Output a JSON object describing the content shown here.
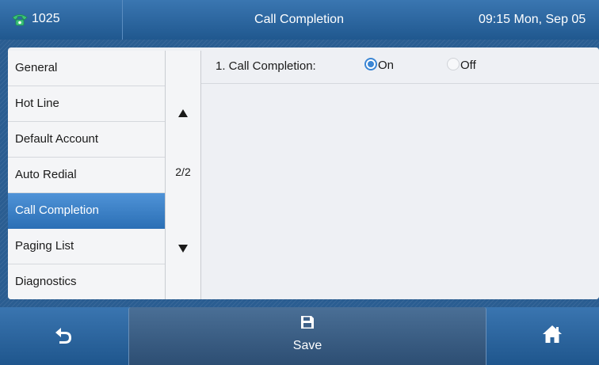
{
  "topbar": {
    "account": "1025",
    "title": "Call Completion",
    "clock": "09:15 Mon, Sep 05"
  },
  "menu": {
    "items": [
      {
        "label": "General"
      },
      {
        "label": "Hot Line"
      },
      {
        "label": "Default Account"
      },
      {
        "label": "Auto Redial"
      },
      {
        "label": "Call Completion",
        "selected": true
      },
      {
        "label": "Paging List"
      },
      {
        "label": "Diagnostics"
      }
    ],
    "page": "2/2"
  },
  "setting": {
    "label": "1. Call Completion:",
    "options": [
      {
        "label": "On",
        "checked": true
      },
      {
        "label": "Off",
        "checked": false
      }
    ]
  },
  "softkeys": {
    "back_icon": "back-arrow-icon",
    "save_label": "Save",
    "save_icon": "floppy-disk-icon",
    "home_icon": "home-icon"
  },
  "colors": {
    "accent": "#3b86d4",
    "selected_item": "#3a7fc4",
    "topbar": "#2a63a0"
  }
}
